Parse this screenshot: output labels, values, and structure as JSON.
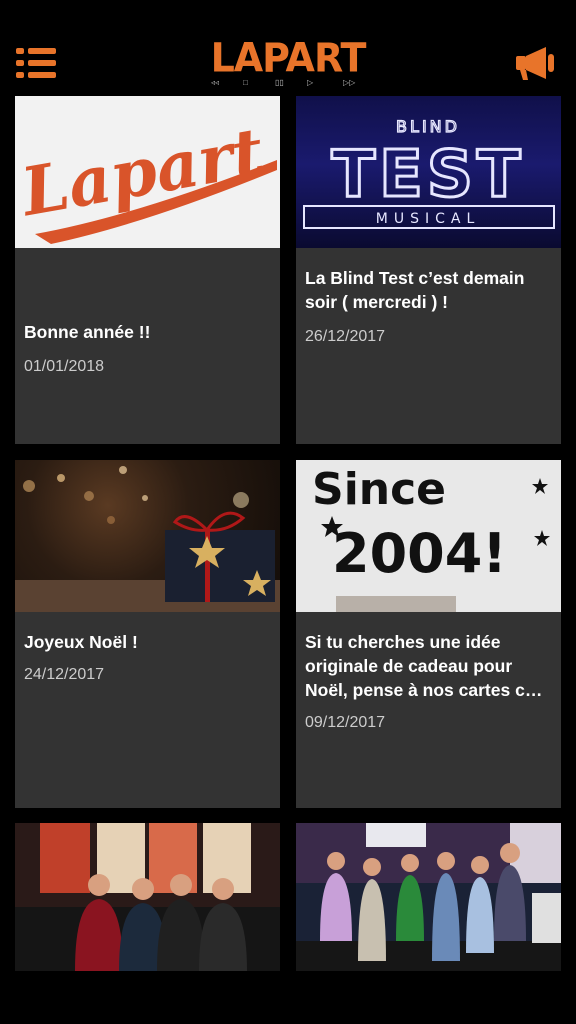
{
  "header": {
    "logo_text": "LAPART",
    "logo_controls": [
      "◃◃",
      "□",
      "▯▯",
      "▷",
      "▷▷"
    ],
    "menu_icon": "hamburger-menu-icon",
    "right_icon": "megaphone-icon",
    "accent": "#e8742a"
  },
  "thumbs": {
    "lapart_script": "Lapart",
    "blind_top": "BLIND",
    "blind_test": "TEST",
    "blind_musical": "MUSICAL",
    "since_text": "Since",
    "since_year": "2004!"
  },
  "posts": [
    {
      "title": "Bonne année !!",
      "date": "01/01/2018"
    },
    {
      "title": "La Blind Test c’est demain soir ( mercredi ) !",
      "date": "26/12/2017"
    },
    {
      "title": "Joyeux Noël !",
      "date": "24/12/2017"
    },
    {
      "title": "Si tu cherches une idée originale de cadeau pour Noël, pense à nos cartes c…",
      "date": "09/12/2017"
    },
    {
      "title": "",
      "date": ""
    },
    {
      "title": "",
      "date": ""
    }
  ]
}
